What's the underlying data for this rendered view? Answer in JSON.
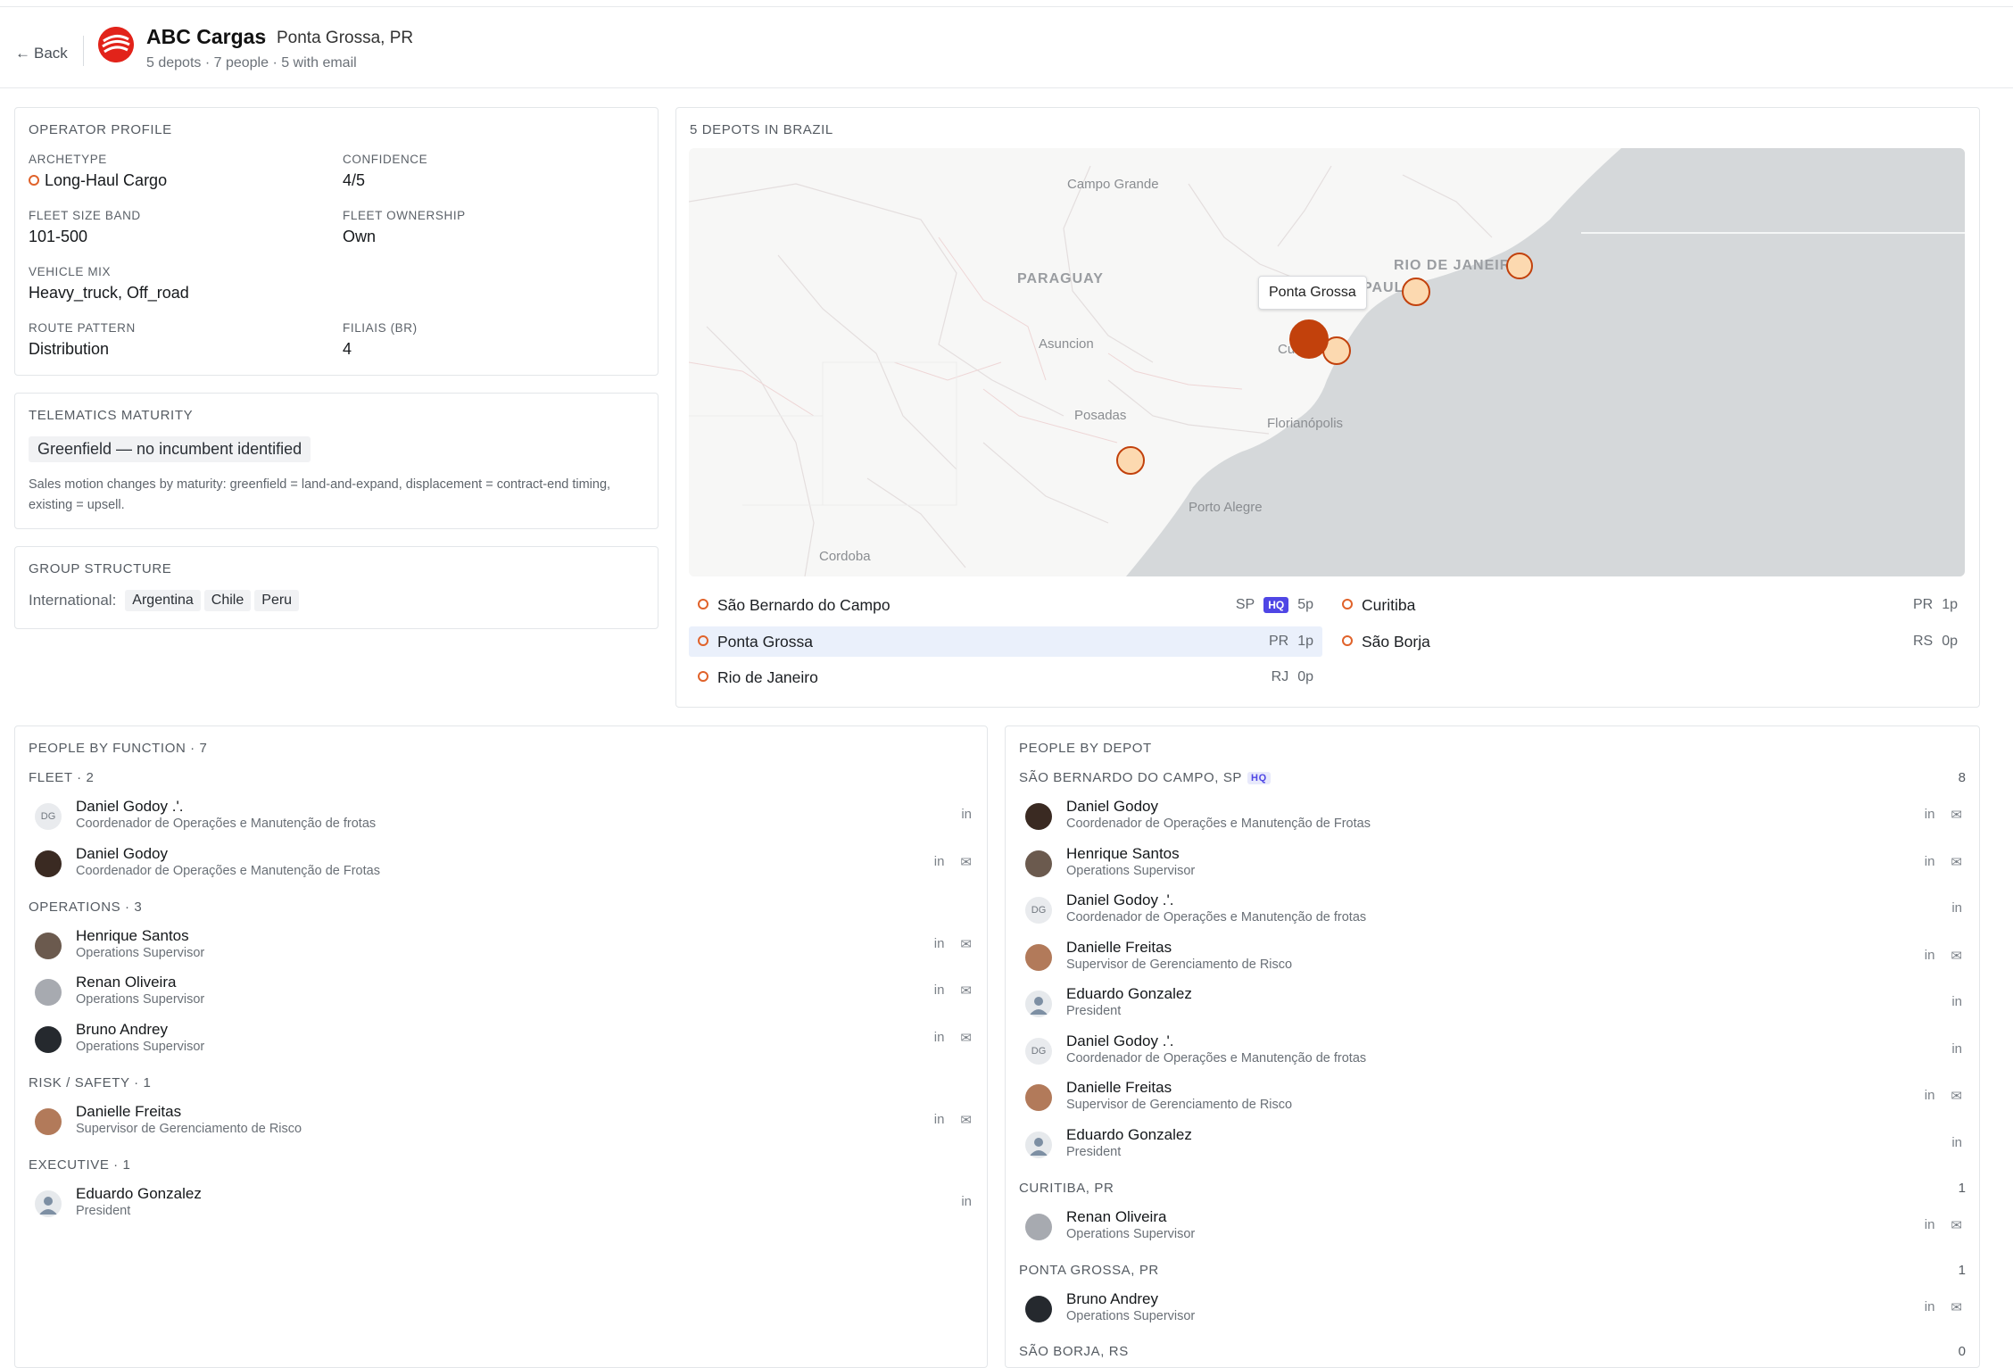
{
  "header": {
    "back_label": "Back",
    "company_name": "ABC Cargas",
    "separator": "·",
    "company_location": "Ponta Grossa, PR",
    "subtitle": "5 depots · 7 people · 5 with email"
  },
  "operator_profile": {
    "title": "OPERATOR PROFILE",
    "fields": [
      {
        "label": "ARCHETYPE",
        "value": "Long-Haul Cargo"
      },
      {
        "label": "CONFIDENCE",
        "value": "4/5"
      },
      {
        "label": "FLEET SIZE BAND",
        "value": "101-500"
      },
      {
        "label": "FLEET OWNERSHIP",
        "value": "Own"
      },
      {
        "label": "VEHICLE MIX",
        "value": "Heavy_truck, Off_road"
      },
      {
        "label": "ROUTE PATTERN",
        "value": "Distribution"
      },
      {
        "label": "FILIAIS (BR)",
        "value": "4"
      }
    ]
  },
  "telematics": {
    "title": "TELEMATICS MATURITY",
    "chip": "Greenfield — no incumbent identified",
    "note": "Sales motion changes by maturity: greenfield = land-and-expand, displacement = contract-end timing, existing = upsell."
  },
  "group_structure": {
    "title": "GROUP STRUCTURE",
    "label": "International:",
    "countries": [
      "Argentina",
      "Chile",
      "Peru"
    ]
  },
  "map": {
    "title": "5 DEPOTS IN BRAZIL",
    "tooltip": "Ponta Grossa",
    "labels": {
      "campo_grande": "Campo Grande",
      "paraguay": "PARAGUAY",
      "asuncion": "Asuncion",
      "posadas": "Posadas",
      "cordoba": "Cordoba",
      "porto_alegre": "Porto Alegre",
      "florianopolis": "Florianópolis",
      "rio": "RIO DE JANEIRO",
      "paulo": "PAULO",
      "cu": "Cu"
    },
    "colors": {
      "accent": "#c2410c",
      "pin_fill": "#fcd9b0",
      "pin_stroke": "#c2410c",
      "ocean": "#d5d8da"
    }
  },
  "depots": [
    {
      "name": "São Bernardo do Campo",
      "state": "SP",
      "hq": "HQ",
      "people": "5p"
    },
    {
      "name": "Curitiba",
      "state": "PR",
      "people": "1p"
    },
    {
      "name": "Ponta Grossa",
      "state": "PR",
      "people": "1p"
    },
    {
      "name": "São Borja",
      "state": "RS",
      "people": "0p"
    },
    {
      "name": "Rio de Janeiro",
      "state": "RJ",
      "people": "0p"
    }
  ],
  "people_by_function": {
    "title": "PEOPLE BY FUNCTION · 7",
    "groups": [
      {
        "title": "FLEET · 2"
      },
      {
        "title": "OPERATIONS · 3"
      },
      {
        "title": "RISK / SAFETY · 1"
      },
      {
        "title": "EXECUTIVE · 1"
      }
    ],
    "people": [
      {
        "name": "Daniel Godoy .'.",
        "role": "Coordenador de Operações e Manutenção de frotas",
        "initials": "DG"
      },
      {
        "name": "Daniel Godoy",
        "role": "Coordenador de Operações e Manutenção de Frotas"
      },
      {
        "name": "Henrique Santos",
        "role": "Operations Supervisor"
      },
      {
        "name": "Renan Oliveira",
        "role": "Operations Supervisor"
      },
      {
        "name": "Bruno Andrey",
        "role": "Operations Supervisor"
      },
      {
        "name": "Danielle Freitas",
        "role": "Supervisor de Gerenciamento de Risco"
      },
      {
        "name": "Eduardo Gonzalez",
        "role": "President"
      }
    ]
  },
  "people_by_depot": {
    "title": "PEOPLE BY DEPOT",
    "groups": [
      {
        "title": "SÃO BERNARDO DO CAMPO, SP",
        "hq": "HQ",
        "count": "8"
      },
      {
        "title": "CURITIBA, PR",
        "count": "1"
      },
      {
        "title": "PONTA GROSSA, PR",
        "count": "1"
      },
      {
        "title": "SÃO BORJA, RS",
        "count": "0"
      }
    ],
    "people": [
      {
        "name": "Daniel Godoy",
        "role": "Coordenador de Operações e Manutenção de Frotas"
      },
      {
        "name": "Henrique Santos",
        "role": "Operations Supervisor"
      },
      {
        "name": "Daniel Godoy .'.",
        "role": "Coordenador de Operações e Manutenção de frotas",
        "initials": "DG"
      },
      {
        "name": "Danielle Freitas",
        "role": "Supervisor de Gerenciamento de Risco"
      },
      {
        "name": "Eduardo Gonzalez",
        "role": "President"
      },
      {
        "name": "Daniel Godoy .'.",
        "role": "Coordenador de Operações e Manutenção de frotas",
        "initials": "DG"
      },
      {
        "name": "Danielle Freitas",
        "role": "Supervisor de Gerenciamento de Risco"
      },
      {
        "name": "Eduardo Gonzalez",
        "role": "President"
      },
      {
        "name": "Renan Oliveira",
        "role": "Operations Supervisor"
      },
      {
        "name": "Bruno Andrey",
        "role": "Operations Supervisor"
      }
    ]
  },
  "actions": {
    "linkedin": "in",
    "email": "✉"
  }
}
